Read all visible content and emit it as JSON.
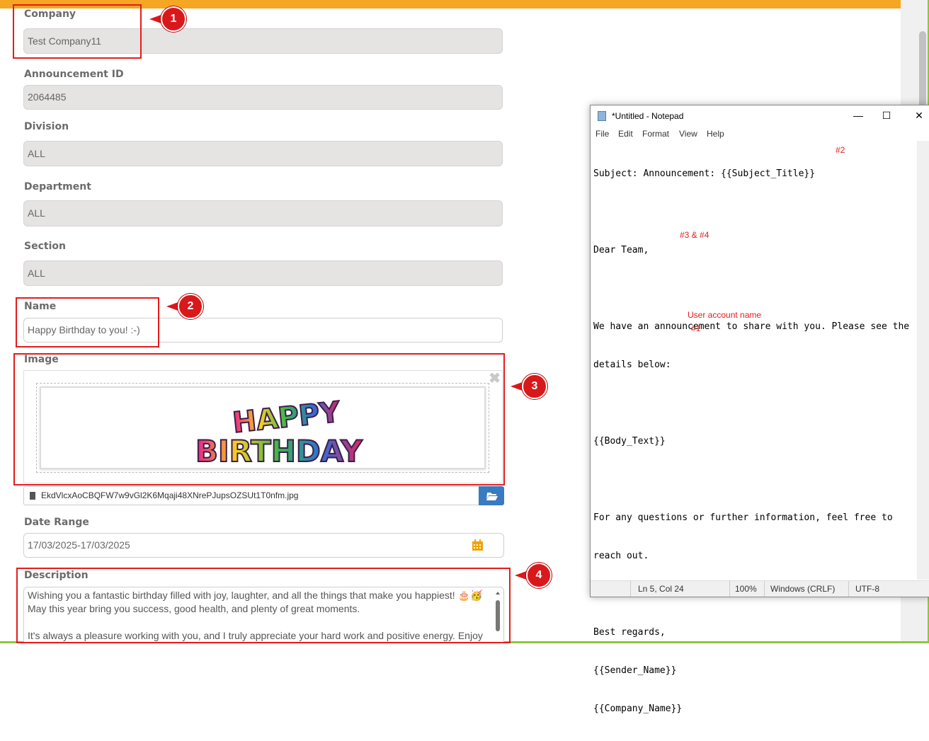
{
  "form": {
    "company_label": "Company",
    "company_value": "Test Company11",
    "announcement_id_label": "Announcement ID",
    "announcement_id_value": "2064485",
    "division_label": "Division",
    "division_value": "ALL",
    "department_label": "Department",
    "department_value": "ALL",
    "section_label": "Section",
    "section_value": "ALL",
    "name_label": "Name",
    "name_value": "Happy Birthday to you! :-)",
    "image_label": "Image",
    "image_text_line1": "HAPPY",
    "image_text_line2": "BIRTHDAY",
    "image_filename": "EkdVlcxAoCBQFW7w9vGl2K6Mqaji48XNrePJupsOZSUt1T0nfm.jpg",
    "date_range_label": "Date Range",
    "date_range_value": "17/03/2025-17/03/2025",
    "description_label": "Description",
    "description_line1": "Wishing you a fantastic birthday filled with joy, laughter, and all the things that make you happiest! 🎂🥳",
    "description_line2": "May this year bring you success, good health, and plenty of great moments.",
    "description_line3": "It's always a pleasure working with you, and I truly appreciate your hard work and positive energy. Enjoy"
  },
  "markers": [
    "1",
    "2",
    "3",
    "4"
  ],
  "notepad": {
    "title": "*Untitled - Notepad",
    "menu": [
      "File",
      "Edit",
      "Format",
      "View",
      "Help"
    ],
    "lines": [
      "Subject: Announcement: {{Subject_Title}}",
      "",
      "Dear Team,",
      "",
      "We have an announcement to share with you. Please see the",
      "details below:",
      "",
      "{{Body_Text}}",
      "",
      "For any questions or further information, feel free to",
      "reach out.",
      "",
      "Best regards,",
      "{{Sender_Name}}",
      "{{Company_Name}}"
    ],
    "annotations": {
      "subject": "#2",
      "body": "#3 & #4",
      "sender": "User account name",
      "company": "#1"
    },
    "status": {
      "position": "Ln 5, Col 24",
      "zoom": "100%",
      "line_ending": "Windows (CRLF)",
      "encoding": "UTF-8"
    }
  },
  "colors": {
    "accent_bar": "#f5a623",
    "annotation_red": "#e51b1b",
    "button_blue": "#3a7ac0"
  }
}
